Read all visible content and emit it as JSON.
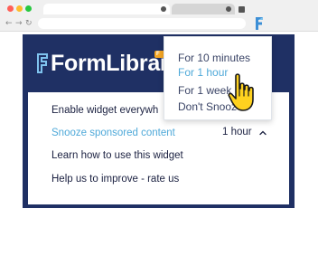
{
  "browser": {
    "back_glyph": "←",
    "forward_glyph": "→",
    "reload_glyph": "↻"
  },
  "extension": {
    "logo_text": "FormLibrar",
    "badge_text": "F",
    "brand_color": "#1f3064",
    "accent_color": "#4fa9d9",
    "badge_color": "#f5a623"
  },
  "menu": {
    "items": [
      {
        "label": "Enable widget everywh"
      },
      {
        "label": "Snooze sponsored content",
        "value": "1 hour"
      },
      {
        "label": "Learn how to use this widget"
      },
      {
        "label": "Help us to improve - rate us"
      }
    ]
  },
  "snooze_dropdown": {
    "options": [
      {
        "label": "For 10 minutes",
        "selected": false
      },
      {
        "label": "For 1 hour",
        "selected": true
      },
      {
        "label": "For 1 week",
        "selected": false
      },
      {
        "label": "Don't Snooz",
        "selected": false
      }
    ]
  },
  "icons": {
    "extension_toolbar": "formlibrary-logo-icon",
    "cursor": "hand-pointer-icon",
    "expand": "chevron-up-icon"
  }
}
